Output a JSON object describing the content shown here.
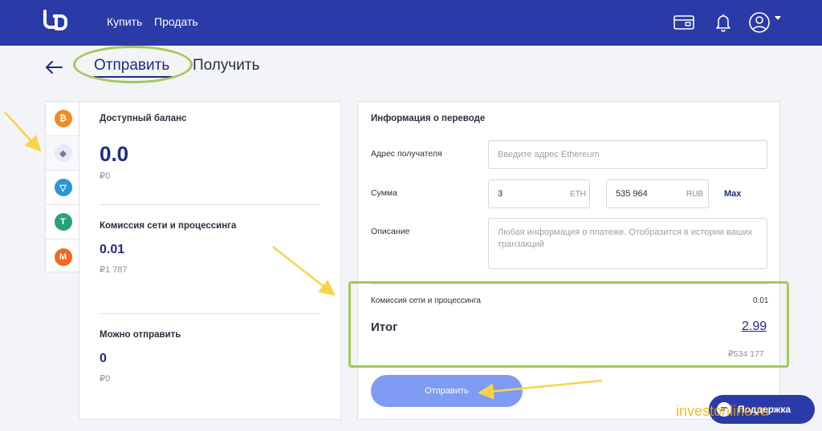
{
  "nav": {
    "buy": "Купить",
    "sell": "Продать"
  },
  "tabs": {
    "send": "Отправить",
    "receive": "Получить"
  },
  "coins": [
    {
      "name": "bitcoin",
      "symbol": "₿",
      "color": "#f08a24"
    },
    {
      "name": "ethereum",
      "symbol": "◆",
      "color": "#6b7bb0"
    },
    {
      "name": "tron",
      "symbol": "▽",
      "color": "#2d96d6"
    },
    {
      "name": "tether",
      "symbol": "T",
      "color": "#26a17b"
    },
    {
      "name": "monero",
      "symbol": "M",
      "color": "#f26822"
    }
  ],
  "balance": {
    "available_label": "Доступный баланс",
    "available_value": "0.0",
    "available_rub": "₽0",
    "fee_label": "Комиссия сети и процессинга",
    "fee_value": "0.01",
    "fee_rub": "₽1 787",
    "sendable_label": "Можно отправить",
    "sendable_value": "0",
    "sendable_rub": "₽0"
  },
  "transfer": {
    "title": "Информация о переводе",
    "address_label": "Адрес получателя",
    "address_placeholder": "Введите адрес Ethereum",
    "amount_label": "Сумма",
    "amount_eth": "3",
    "amount_eth_unit": "ETH",
    "amount_rub": "535 964",
    "amount_rub_unit": "RUB",
    "max_label": "Max",
    "description_label": "Описание",
    "description_placeholder": "Любая информация о платеже. Отобразится в истории ваших транзакций",
    "fee_label": "Комиссия сети и процессинга",
    "fee_value": "0.01",
    "total_label": "Итог",
    "total_value": "2.99",
    "total_rub": "₽534 177",
    "send_button": "Отправить"
  },
  "support": {
    "label": "Поддержка"
  },
  "watermark": "investonline.ru",
  "colors": {
    "primary": "#2a3aa7",
    "accent_blue": "#1f2a86",
    "button": "#7f9bf3",
    "highlight_green": "#a3c85a",
    "arrow_yellow": "#f7d54a"
  }
}
